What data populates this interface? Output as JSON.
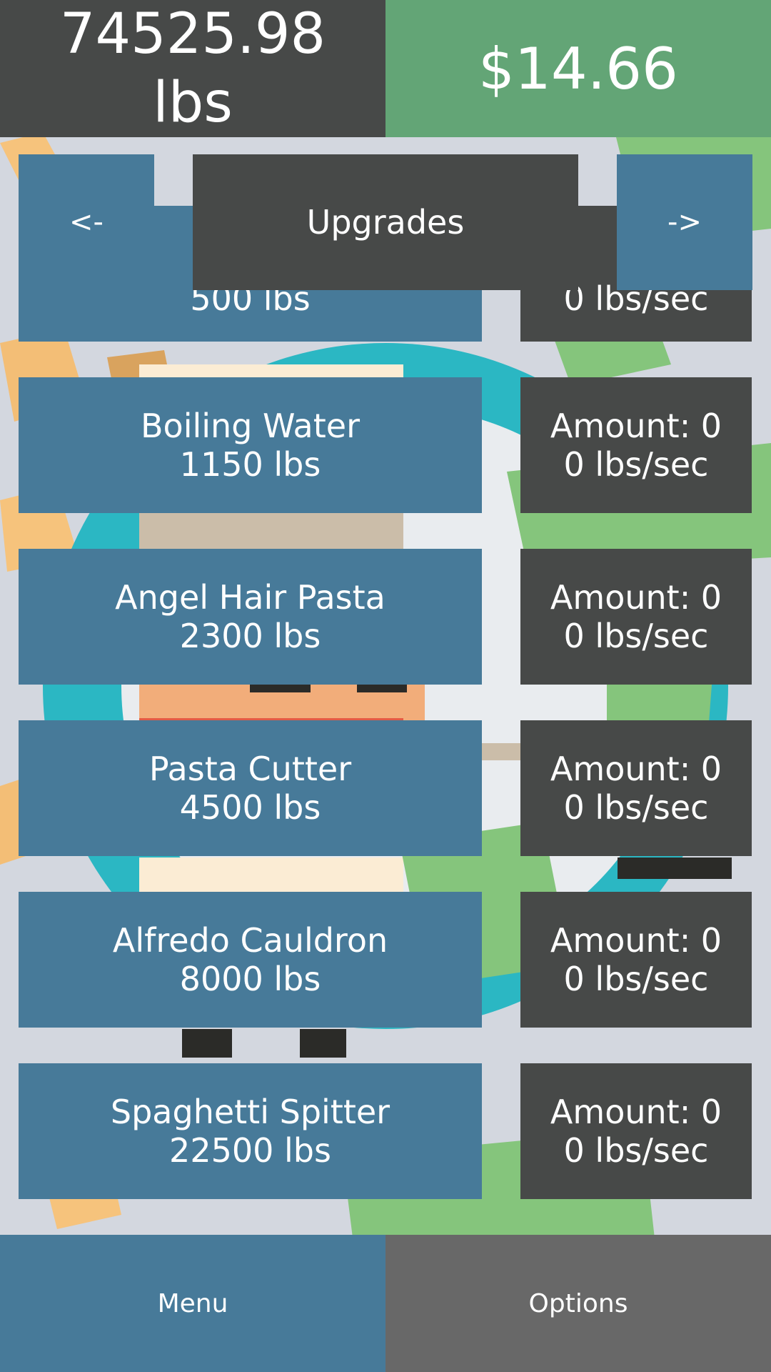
{
  "header": {
    "weight_value": "74525.98",
    "weight_unit": "lbs",
    "money": "$14.66"
  },
  "nav": {
    "prev_label": "<-",
    "title": "Upgrades",
    "next_label": "->"
  },
  "upgrades": [
    {
      "name": "",
      "cost": "500 lbs",
      "amount": "",
      "rate": "0 lbs/sec"
    },
    {
      "name": "Boiling Water",
      "cost": "1150 lbs",
      "amount": "Amount: 0",
      "rate": "0 lbs/sec"
    },
    {
      "name": "Angel Hair Pasta",
      "cost": "2300 lbs",
      "amount": "Amount: 0",
      "rate": "0 lbs/sec"
    },
    {
      "name": "Pasta Cutter",
      "cost": "4500 lbs",
      "amount": "Amount: 0",
      "rate": "0 lbs/sec"
    },
    {
      "name": "Alfredo Cauldron",
      "cost": "8000 lbs",
      "amount": "Amount: 0",
      "rate": "0 lbs/sec"
    },
    {
      "name": "Spaghetti Spitter",
      "cost": "22500 lbs",
      "amount": "Amount: 0",
      "rate": "0 lbs/sec"
    }
  ],
  "footer": {
    "menu_label": "Menu",
    "options_label": "Options"
  },
  "colors": {
    "panel_blue": "#477a99",
    "panel_dark": "#474948",
    "money_green": "#63a576",
    "options_grey": "#686868",
    "background": "#d3d7df"
  },
  "icons": [
    "cardboard-box-icon",
    "chef-character-icon",
    "money-bill-icon",
    "teal-plate-icon"
  ]
}
